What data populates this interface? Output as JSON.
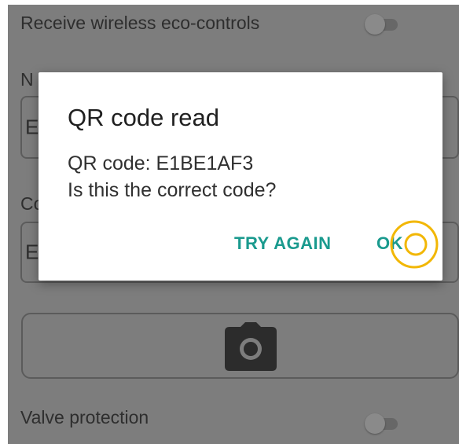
{
  "settings": {
    "wireless_label": "Receive wireless eco-controls",
    "name_label_partial": "N",
    "name_value_partial": "E",
    "code_label_partial": "Co",
    "code_value_partial": "E",
    "valve_label": "Valve protection",
    "camera_button_icon": "camera-icon"
  },
  "dialog": {
    "title": "QR code read",
    "message_line1": "QR code: E1BE1AF3",
    "message_line2": "Is this the correct code?",
    "try_again_label": "TRY AGAIN",
    "ok_label": "OK"
  },
  "colors": {
    "accent": "#1a9a8e",
    "scrim": "#7d7d7d",
    "tap_highlight": "#f2b705"
  }
}
